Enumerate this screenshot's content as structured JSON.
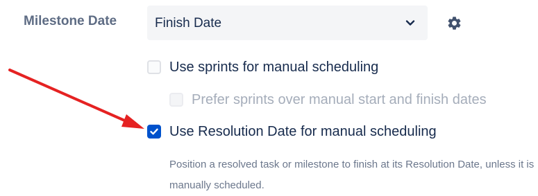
{
  "milestone": {
    "label": "Milestone Date",
    "select_value": "Finish Date",
    "chevron_icon": "chevron-down-icon",
    "gear_icon": "gear-icon"
  },
  "options": [
    {
      "label": "Use sprints for manual scheduling",
      "checked": false,
      "disabled": false
    },
    {
      "label": "Prefer sprints over manual start and finish dates",
      "checked": false,
      "disabled": true
    },
    {
      "label": "Use Resolution Date for manual scheduling",
      "checked": true,
      "disabled": false
    }
  ],
  "resolution_description": "Position a resolved task or milestone to finish at its Resolution Date, unless it is manually scheduled.",
  "annotation": {
    "arrow_color": "#e52222"
  },
  "colors": {
    "accent": "#0052cc",
    "label": "#5e6c84",
    "text": "#172b4d"
  }
}
